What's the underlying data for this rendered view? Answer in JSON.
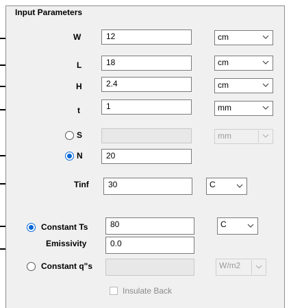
{
  "title": "Input Parameters",
  "rows": {
    "W": {
      "label": "W",
      "value": "12",
      "unit": "cm"
    },
    "L": {
      "label": "L",
      "value": "18",
      "unit": "cm"
    },
    "H": {
      "label": "H",
      "value": "2.4",
      "unit": "cm"
    },
    "t": {
      "label": "t",
      "value": "1",
      "unit": "mm"
    },
    "S": {
      "label": "S",
      "value": "",
      "unit": "mm",
      "selected": false
    },
    "N": {
      "label": "N",
      "value": "20",
      "selected": true
    },
    "Tinf": {
      "label": "Tinf",
      "value": "30",
      "unit": "C"
    }
  },
  "bottom": {
    "constant_ts": {
      "label": "Constant Ts",
      "value": "80",
      "unit": "C",
      "selected": true
    },
    "emissivity": {
      "label": "Emissivity",
      "value": "0.0"
    },
    "constant_q": {
      "label": "Constant q\"s",
      "value": "",
      "unit": "W/m2",
      "selected": false
    },
    "insulate_back": {
      "label": "Insulate Back",
      "checked": false
    }
  },
  "colors": {
    "accent": "#0066d6",
    "panel_bg": "#f0f0f0"
  }
}
